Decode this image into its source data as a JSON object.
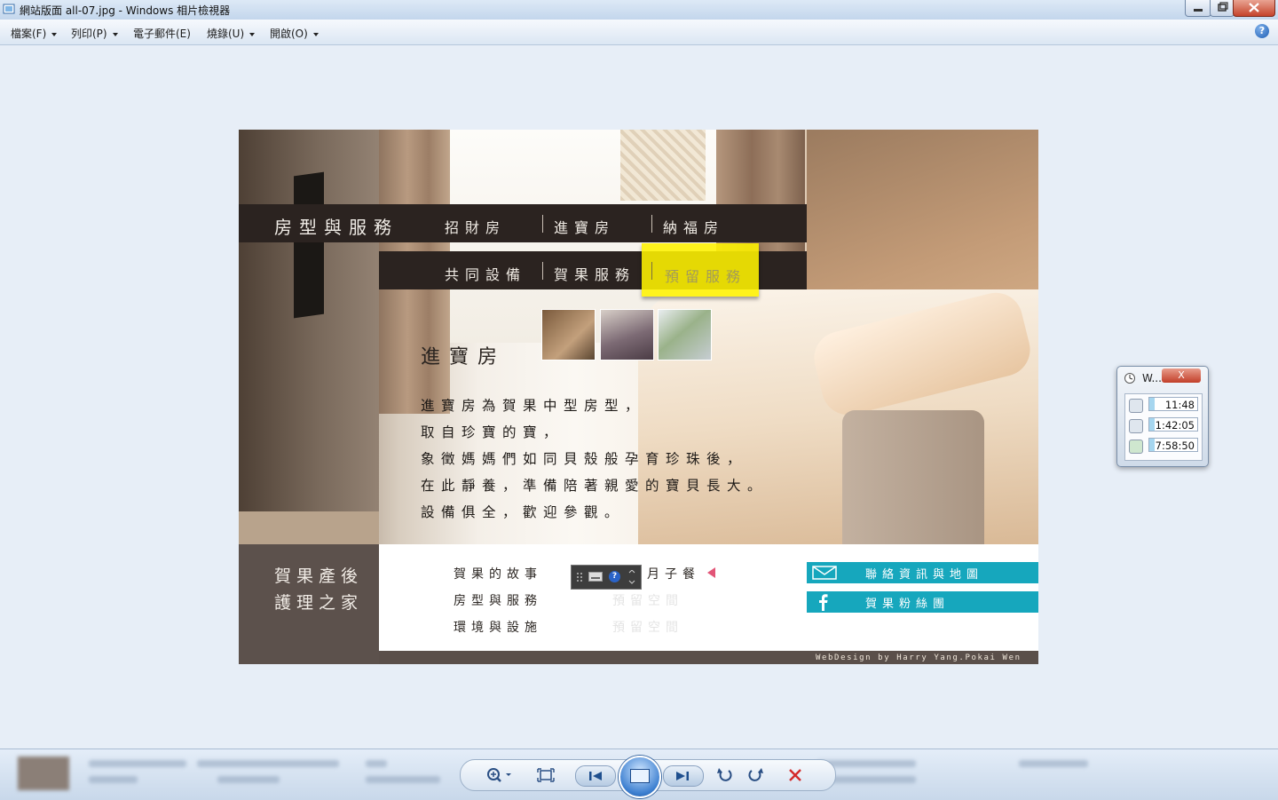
{
  "window": {
    "title": "網站版面 all-07.jpg - Windows 相片檢視器"
  },
  "menu": [
    {
      "label": "檔案(F)",
      "has_dropdown": true
    },
    {
      "label": "列印(P)",
      "has_dropdown": true
    },
    {
      "label": "電子郵件(E)",
      "has_dropdown": false
    },
    {
      "label": "燒錄(U)",
      "has_dropdown": true
    },
    {
      "label": "開啟(O)",
      "has_dropdown": true
    }
  ],
  "design": {
    "nav_title": "房型與服務",
    "nav_main": [
      "招財房",
      "進寶房",
      "納福房"
    ],
    "nav_sub": [
      "共同設備",
      "賀果服務",
      "預留服務"
    ],
    "room_title": "進寶房",
    "description": [
      "進寶房為賀果中型房型，",
      "取自珍寶的寶，",
      "象徵媽媽們如同貝殼般孕育珍珠後，",
      "在此靜養，準備陪著親愛的寶貝長大。",
      "設備俱全，歡迎參觀。"
    ],
    "brand": [
      "賀果產後",
      "護理之家"
    ],
    "footer_links": [
      "賀果的故事",
      "房型與服務",
      "環境與設施"
    ],
    "footer_links_2": [
      "月子餐",
      "預留空間",
      "預留空間"
    ],
    "contact_button": "聯絡資訊與地圖",
    "fans_button": "賀果粉絲團",
    "credit": "WebDesign by Harry Yang.Pokai Wen",
    "accent_color": "#16a7bd",
    "highlight_color": "#fff200"
  },
  "gadget": {
    "title": "W...",
    "close": "X",
    "rows": [
      {
        "icon": "mouse-icon",
        "value": "11:48"
      },
      {
        "icon": "keyboard-icon",
        "value": "1:42:05"
      },
      {
        "icon": "logon-icon",
        "value": "7:58:50"
      }
    ]
  }
}
